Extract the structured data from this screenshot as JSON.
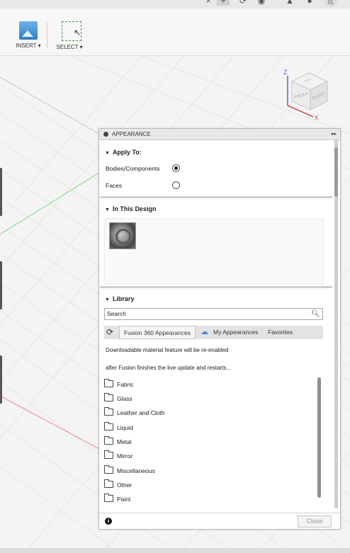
{
  "titlebar": {
    "close_icon": "close-icon",
    "add_icon": "plus-icon"
  },
  "toolbar": {
    "insert_label": "INSERT ▾",
    "select_label": "SELECT ▾"
  },
  "viewcube": {
    "axis_z": "Z",
    "axis_x": "X",
    "face_front": "FRONT",
    "face_right": "RIGHT",
    "face_top": "TOP"
  },
  "panel": {
    "title": "APPEARANCE",
    "expand_icon": "▸▸",
    "apply_to": {
      "heading": "Apply To:",
      "options": [
        {
          "label": "Bodies/Components",
          "selected": true
        },
        {
          "label": "Faces",
          "selected": false
        }
      ]
    },
    "in_this_design": {
      "heading": "In This Design"
    },
    "library": {
      "heading": "Library",
      "search_placeholder": "Search",
      "tabs": [
        {
          "label": "Fusion 360 Appearances",
          "active": true
        },
        {
          "label": "My Appearances",
          "active": false
        },
        {
          "label": "Favorites",
          "active": false
        }
      ],
      "message_1": "Downloadable material feature will be re-enabled",
      "message_2": "after Fusion finishes the live update and restarts...",
      "folders": [
        "Fabric",
        "Glass",
        "Leather and Cloth",
        "Liquid",
        "Metal",
        "Mirror",
        "Miscellaneous",
        "Other",
        "Paint"
      ]
    },
    "close_label": "Close",
    "info_icon": "i"
  },
  "colors": {
    "grid": "#d9d9d9",
    "axis_green": "#7fd97f",
    "axis_red": "#f08c8c",
    "selected_radio": "#111111"
  }
}
